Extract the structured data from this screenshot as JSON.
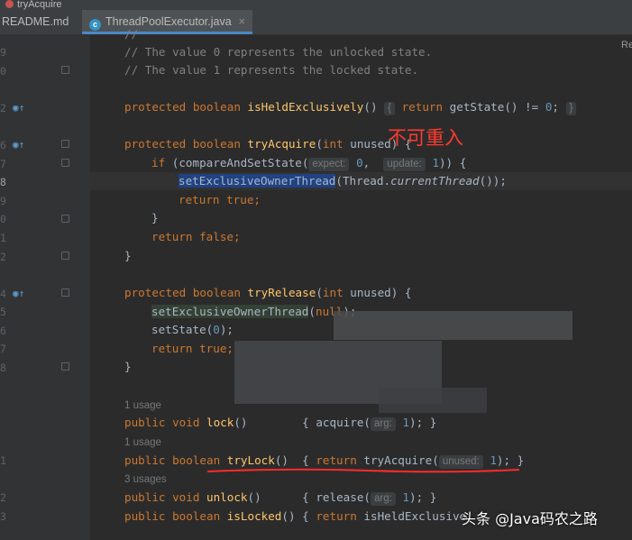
{
  "breadcrumb": {
    "label": "tryAcquire"
  },
  "tabs": [
    {
      "label": "README.md"
    },
    {
      "label": "ThreadPoolExecutor.java",
      "close": "×",
      "icon_letter": "c"
    }
  ],
  "right_panel_label": "Re",
  "gutter": {
    "line_numbers": [
      "",
      "9",
      "0",
      "",
      "2",
      "",
      "6",
      "7",
      "8",
      "9",
      "0",
      "1",
      "2",
      "",
      "4",
      "5",
      "6",
      "7",
      "8",
      "",
      "",
      "",
      "",
      "",
      "1",
      "",
      "2",
      "3"
    ]
  },
  "code": {
    "comment0": "//",
    "comment1": "// The value 0 represents the unlocked state.",
    "comment2": "// The value 1 represents the locked state.",
    "isHeld": {
      "mods": "protected boolean ",
      "name": "isHeldExclusively",
      "rest1": "() ",
      "lb": "{",
      "ret": " return ",
      "call": "getState() != ",
      "num": "0",
      "end": "; ",
      "rb": "}"
    },
    "tryAcq": {
      "mods": "protected boolean ",
      "name": "tryAcquire",
      "params1": "(",
      "kwint": "int",
      "params2": " unused) {"
    },
    "ifline": {
      "kwif": "if",
      "p1": " (compareAndSetState(",
      "hint1": "expect:",
      "n1": " 0",
      "c": ",  ",
      "hint2": "update:",
      "n2": " 1",
      "p2": ")) {"
    },
    "setOwner": {
      "sel": "setExclusiveOwnerThread",
      "p1": "(Thread.",
      "it": "currentThread",
      "p2": "());"
    },
    "retTrue": {
      "kw": "return true",
      "semi": ";"
    },
    "rb1": "}",
    "retFalse": {
      "kw": "return false",
      "semi": ";"
    },
    "rb2": "}",
    "tryRel": {
      "mods": "protected boolean ",
      "name": "tryRelease",
      "params1": "(",
      "kwint": "int",
      "params2": " unused) {"
    },
    "setOwnerNull": {
      "green": "setExclusiveOwnerThread",
      "p1": "(",
      "kwnull": "null",
      "p2": ");"
    },
    "setState": {
      "p1": "setState(",
      "num": "0",
      "p2": ");"
    },
    "retTrue2": {
      "kw": "return true",
      "semi": ";"
    },
    "rb3": "}",
    "usage1": "1 usage",
    "lock": {
      "mods": "public void ",
      "name": "lock",
      "p1": "()        { acquire(",
      "hint": "arg:",
      "num": " 1",
      "p2": "); }"
    },
    "usage2": "1 usage",
    "tryLock": {
      "mods": "public boolean ",
      "name": "tryLock",
      "p1": "()  { ",
      "kwret": "return",
      "p2": " tryAcquire(",
      "hint": "unused:",
      "num": " 1",
      "p3": "); }"
    },
    "usage3": "3 usages",
    "unlock": {
      "mods": "public void ",
      "name": "unlock",
      "p1": "()      { release(",
      "hint": "arg:",
      "num": " 1",
      "p2": "); }"
    },
    "isLocked": {
      "mods": "public boolean ",
      "name": "isLocked",
      "p1": "() { ",
      "kwret": "return",
      "p2": " isHeldExclusive"
    }
  },
  "annotation": "不可重入",
  "watermark": "头条 @Java码农之路",
  "colors": {
    "keyword": "#cc7832",
    "method": "#ffc66d",
    "number": "#6897bb",
    "comment": "#808080",
    "annotation": "#ff3b30"
  }
}
